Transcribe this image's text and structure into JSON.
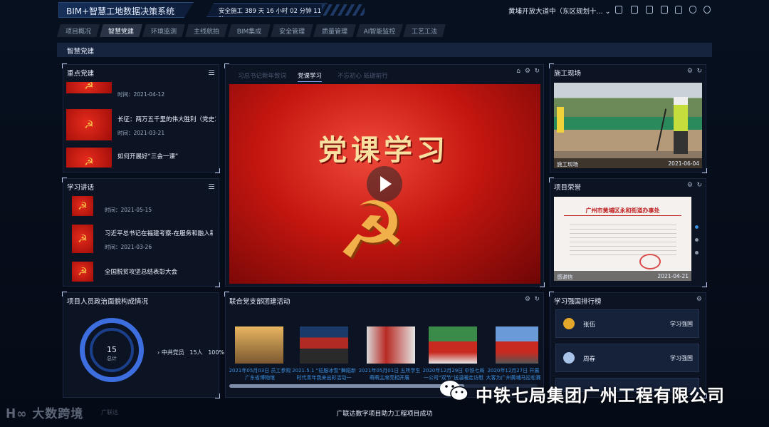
{
  "app": {
    "title": "BIM+智慧工地数据决策系统",
    "countdown": "安全施工 389 天 16 小时 02 分钟 11 秒",
    "project": "黄埔开放大道中（东区规划十...",
    "tools": [
      "grid-icon",
      "table-icon",
      "window-icon",
      "monitor-icon",
      "shirt-icon",
      "shield-icon",
      "user-icon"
    ]
  },
  "tabs": [
    {
      "label": "项目概况",
      "active": false
    },
    {
      "label": "智慧党建",
      "active": true
    },
    {
      "label": "环境监测",
      "active": false
    },
    {
      "label": "主线航拍",
      "active": false
    },
    {
      "label": "BIM集成",
      "active": false
    },
    {
      "label": "安全管理",
      "active": false
    },
    {
      "label": "质量管理",
      "active": false
    },
    {
      "label": "AI智能监控",
      "active": false
    },
    {
      "label": "工艺工法",
      "active": false
    }
  ],
  "subhead": "智慧党建",
  "key_party": {
    "title": "重点党建",
    "items": [
      {
        "title": "",
        "date": "时间：2021-04-12"
      },
      {
        "title": "长征：两万五千里的伟大胜利（党史1...",
        "date": "2021-03-21"
      },
      {
        "title": "如何开展好“三会一课”",
        "date": ""
      }
    ]
  },
  "study_talk": {
    "title": "学习讲话",
    "items": [
      {
        "title": "",
        "date": "时间：2021-05-15"
      },
      {
        "title": "习近平总书记在福建考察-在服务和融入新发...",
        "date": "时间：2021-03-26"
      },
      {
        "title": "全国脱贫攻坚总结表彰大会",
        "date": ""
      }
    ]
  },
  "video_panel": {
    "tabs": [
      "习总书记新年致词",
      "党课学习",
      "不忘初心 砥砺前行"
    ],
    "active_tab": 1,
    "video_title": "党课学习"
  },
  "site": {
    "title": "施工现场",
    "caption": "施工现场",
    "date": "2021-06-04"
  },
  "honor": {
    "title": "项目荣誉",
    "caption": "感谢信",
    "date": "2021-04-21",
    "doc_heading": "广州市黄埔区永和街道办事处"
  },
  "political": {
    "title": "项目人员政治面貌构成情况",
    "total": "15",
    "total_label": "总计",
    "legend": [
      {
        "name": "中共党员",
        "count": "15人",
        "pct": "100%"
      }
    ],
    "chart_data": {
      "type": "pie",
      "categories": [
        "中共党员"
      ],
      "values": [
        15
      ]
    }
  },
  "activities": {
    "title": "联合党支部团建活动",
    "items": [
      "2021年05月03日 员工参观广东省博物馆",
      "2021.5.1 “征服冰雪”舞蹈新时代青年我来出彩活动一",
      "2021年05月01日 五所学生萌萌主席亮相开展",
      "2020年12月29日 中铁七局一公司“双节”送温暖走访慰问活动",
      "2020年12月27日 开展大客为广州黄埔马拉松赛事服务"
    ]
  },
  "ranking": {
    "title": "学习强国排行榜",
    "items": [
      {
        "name": "张伍",
        "tag": "学习强国",
        "medal": "#e2a72b"
      },
      {
        "name": "周春",
        "tag": "学习强国",
        "medal": "#a9c4e8"
      }
    ]
  },
  "footer": {
    "center": "广联达数字项目助力工程项目成功",
    "watermark": "大数跨境",
    "watermark_small": "广联达",
    "company": "中铁七局集团广州工程有限公司"
  }
}
